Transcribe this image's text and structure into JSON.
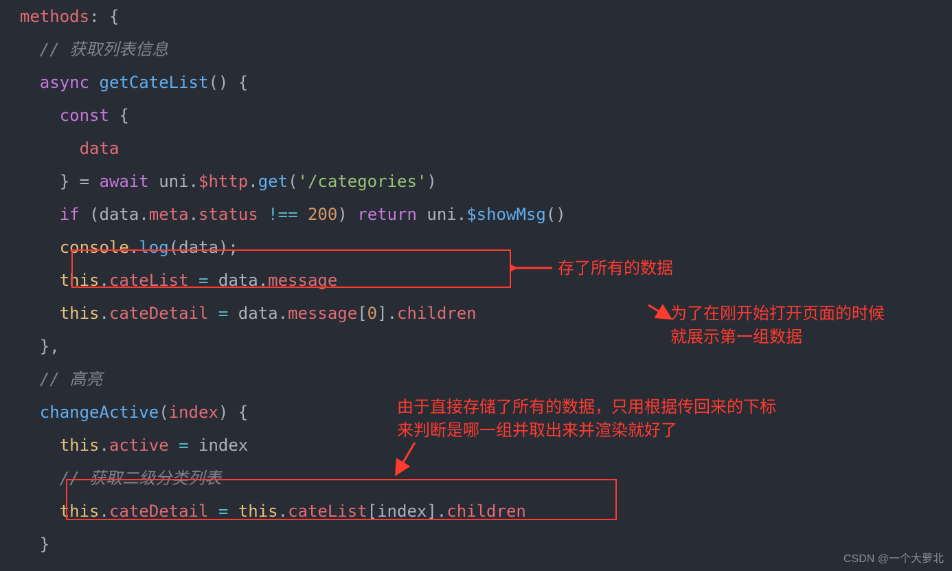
{
  "code": {
    "l1": {
      "a": "methods",
      "b": ": {"
    },
    "l2": {
      "a": "// ",
      "b": "获取列表信息"
    },
    "l3": {
      "a": "async",
      "b": "getCateList",
      "c": "() {"
    },
    "l4": {
      "a": "const",
      "b": " {"
    },
    "l5": {
      "a": "data"
    },
    "l6": {
      "a": "} = ",
      "b": "await",
      "c": " uni.",
      "d": "$http",
      "e": ".",
      "f": "get",
      "g": "(",
      "h": "'/categories'",
      "i": ")"
    },
    "l7": {
      "a": "if",
      "b": " (data.",
      "c": "meta",
      "d": ".",
      "e": "status",
      "f": " ",
      "g": "!==",
      "h": " ",
      "i": "200",
      "j": ") ",
      "k": "return",
      "l": " uni.",
      "m": "$showMsg",
      "n": "()"
    },
    "l8": {
      "a": "console",
      "b": ".",
      "c": "log",
      "d": "(data);"
    },
    "l9": {
      "a": "this",
      "b": ".",
      "c": "cateList",
      "d": " ",
      "e": "=",
      "f": " data.",
      "g": "message"
    },
    "l10": {
      "a": "this",
      "b": ".",
      "c": "cateDetail",
      "d": " ",
      "e": "=",
      "f": " data.",
      "g": "message",
      "h": "[",
      "i": "0",
      "j": "].",
      "k": "children"
    },
    "l11": {
      "a": "},"
    },
    "l12": {
      "a": "// ",
      "b": "高亮"
    },
    "l13": {
      "a": "changeActive",
      "b": "(",
      "c": "index",
      "d": ") {"
    },
    "l14": {
      "a": "this",
      "b": ".",
      "c": "active",
      "d": " ",
      "e": "=",
      "f": " index"
    },
    "l15": {
      "a": "// ",
      "b": "获取二级分类列表"
    },
    "l16": {
      "a": "this",
      "b": ".",
      "c": "cateDetail",
      "d": " ",
      "e": "=",
      "f": " ",
      "g": "this",
      "h": ".",
      "i": "cateList",
      "j": "[index].",
      "k": "children"
    },
    "l17": {
      "a": "}"
    }
  },
  "annotations": {
    "a1": "存了所有的数据",
    "a2_line1": "为了在刚开始打开页面的时候",
    "a2_line2": "就展示第一组数据",
    "a3_line1": "由于直接存储了所有的数据，只用根据传回来的下标",
    "a3_line2": "来判断是哪一组并取出来并渲染就好了"
  },
  "watermark": "CSDN @一个大萝北"
}
